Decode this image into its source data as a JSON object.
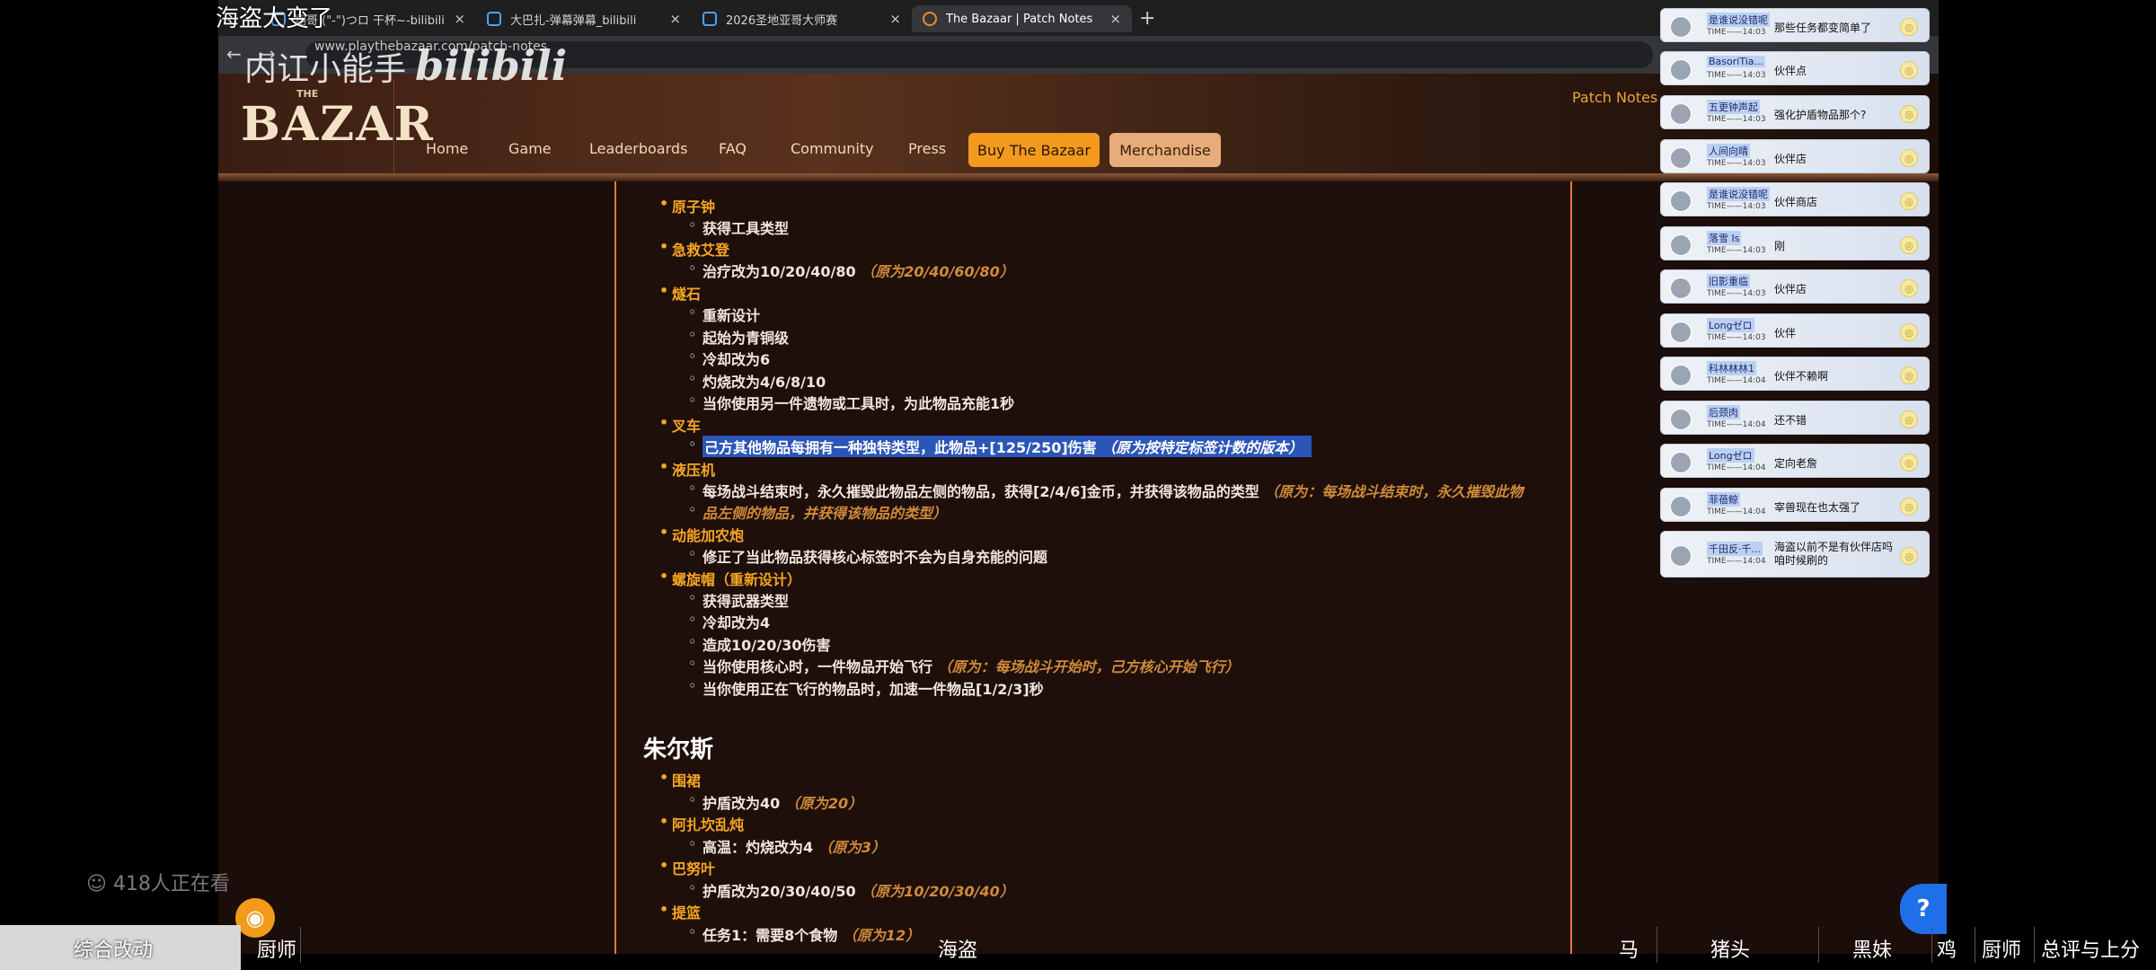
{
  "browser": {
    "tabs": [
      {
        "label": "翔哥 (\"-\")つロ 干杯~-bilibili",
        "active": false
      },
      {
        "label": "大巴扎-弹幕弹幕_bilibili",
        "active": false
      },
      {
        "label": "2026圣地亚哥大师赛",
        "active": false
      },
      {
        "label": "The Bazaar | Patch Notes",
        "active": true
      }
    ],
    "new_tab": "+",
    "close": "×",
    "url": "www.playthebazaar.com/patch-notes"
  },
  "site": {
    "logo_the": "THE",
    "logo_word": "BAZAR",
    "nav": [
      "Home",
      "Game",
      "Leaderboards",
      "FAQ",
      "Community",
      "Press"
    ],
    "buy_button": "Buy The Bazaar",
    "merch_button": "Merchandise",
    "patch_notes_link": "Patch Notes"
  },
  "article": {
    "items": [
      {
        "title": "原子钟",
        "subs": [
          {
            "text": "获得工具类型",
            "orig": ""
          }
        ]
      },
      {
        "title": "急救艾登",
        "subs": [
          {
            "text": "治疗改为10/20/40/80",
            "orig": "（原为20/40/60/80）"
          }
        ]
      },
      {
        "title": "燧石",
        "subs": [
          {
            "text": "重新设计",
            "orig": ""
          },
          {
            "text": "起始为青铜级",
            "orig": ""
          },
          {
            "text": "冷却改为6",
            "orig": ""
          },
          {
            "text": "灼烧改为4/6/8/10",
            "orig": ""
          },
          {
            "text": "当你使用另一件遗物或工具时，为此物品充能1秒",
            "orig": ""
          }
        ]
      },
      {
        "title": "叉车",
        "subs": [
          {
            "text": "己方其他物品每拥有一种独特类型，此物品+[125/250]伤害",
            "orig": "（原为按特定标签计数的版本）"
          }
        ]
      },
      {
        "title": "液压机",
        "subs": [
          {
            "text": "每场战斗结束时，永久摧毁此物品左侧的物品，获得[2/4/6]金币，并获得该物品的类型",
            "orig": "（原为：每场战斗结束时，永久摧毁此物"
          },
          {
            "text": "",
            "orig": "品左侧的物品，并获得该物品的类型）"
          }
        ]
      },
      {
        "title": "动能加农炮",
        "subs": [
          {
            "text": "修正了当此物品获得核心标签时不会为自身充能的问题",
            "orig": ""
          }
        ]
      },
      {
        "title": "螺旋帽（重新设计）",
        "subs": [
          {
            "text": "获得武器类型",
            "orig": ""
          },
          {
            "text": "冷却改为4",
            "orig": ""
          },
          {
            "text": "造成10/20/30伤害",
            "orig": ""
          },
          {
            "text": "当你使用核心时，一件物品开始飞行",
            "orig": "（原为：每场战斗开始时，己方核心开始飞行）"
          },
          {
            "text": "当你使用正在飞行的物品时，加速一件物品[1/2/3]秒",
            "orig": ""
          }
        ]
      }
    ],
    "hero": "朱尔斯",
    "hero_items": [
      {
        "title": "围裙",
        "subs": [
          {
            "text": "护盾改为40",
            "orig": "（原为20）"
          }
        ]
      },
      {
        "title": "阿扎坎乱炖",
        "subs": [
          {
            "text": "高温：灼烧改为4",
            "orig": "（原为3）"
          }
        ]
      },
      {
        "title": "巴努叶",
        "subs": [
          {
            "text": "护盾改为20/30/40/50",
            "orig": "（原为10/20/30/40）"
          }
        ]
      },
      {
        "title": "提篮",
        "subs": [
          {
            "text": "任务1：需要8个食物",
            "orig": "（原为12）"
          }
        ]
      }
    ]
  },
  "overlay": {
    "video_title": "海盗大变了",
    "watermark_text": "内讧小能手",
    "watermark_logo": "bilibili",
    "viewers": "418人正在看",
    "bottom_left": "综合改动",
    "bottom_labels": [
      "厨师",
      "海盗",
      "马",
      "猪头",
      "黑妹",
      "鸡",
      "厨师",
      "总评与上分"
    ],
    "help": "?"
  },
  "danmaku": [
    {
      "name": "是谁说没错呢",
      "time": "TIME——14:03",
      "msg": "那些任务都变简单了"
    },
    {
      "name": "BasoriTia...",
      "time": "TIME——14:03",
      "msg": "伙伴点"
    },
    {
      "name": "五更钟声起",
      "time": "TIME——14:03",
      "msg": "强化护盾物品那个?"
    },
    {
      "name": "人间向晴",
      "time": "TIME——14:03",
      "msg": "伙伴店"
    },
    {
      "name": "是谁说没错呢",
      "time": "TIME——14:03",
      "msg": "伙伴商店"
    },
    {
      "name": "落雪 Is",
      "time": "TIME——14:03",
      "msg": "刚"
    },
    {
      "name": "旧影重临",
      "time": "TIME——14:03",
      "msg": "伙伴店"
    },
    {
      "name": "Longゼロ",
      "time": "TIME——14:03",
      "msg": "伙伴"
    },
    {
      "name": "科林林林1",
      "time": "TIME——14:04",
      "msg": "伙伴不赖啊"
    },
    {
      "name": "后颈肉",
      "time": "TIME——14:04",
      "msg": "还不错"
    },
    {
      "name": "Longゼロ",
      "time": "TIME——14:04",
      "msg": "定向老詹"
    },
    {
      "name": "菲蓓鲸",
      "time": "TIME——14:04",
      "msg": "宰兽现在也太强了"
    },
    {
      "name": "千田反·千...",
      "time": "TIME——14:04",
      "msg": "海盗以前不是有伙伴店吗 咱时候刷的"
    }
  ],
  "colors": {
    "accent": "#f39a1e",
    "item_title": "#f6a623",
    "highlight": "#2b56b8",
    "border": "#e07a38"
  }
}
